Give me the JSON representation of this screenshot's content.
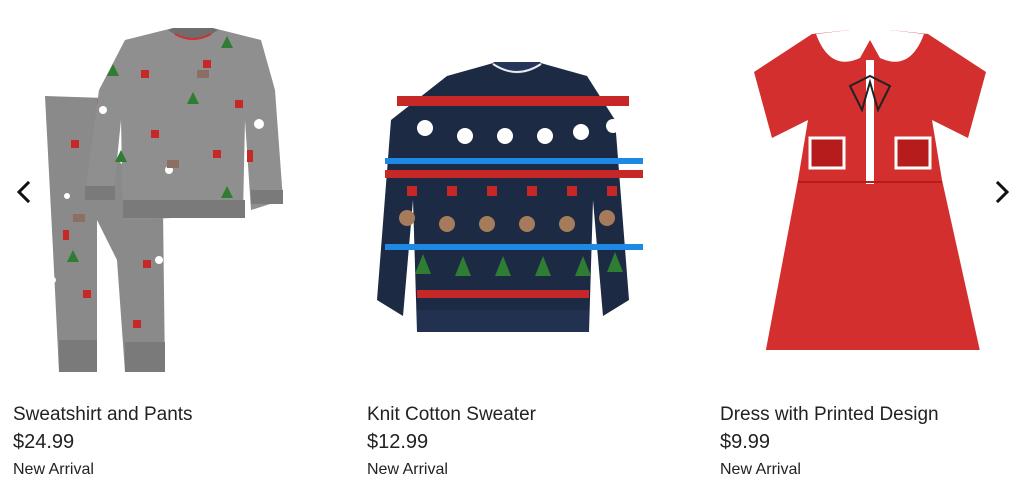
{
  "carousel": {
    "prev_icon": "chevron-left-icon",
    "next_icon": "chevron-right-icon",
    "products": [
      {
        "name": "Sweatshirt and Pants",
        "price": "$24.99",
        "badge": "New Arrival",
        "image": "gray-holiday-print-sweatshirt-and-pants"
      },
      {
        "name": "Knit Cotton Sweater",
        "price": "$12.99",
        "badge": "New Arrival",
        "image": "navy-fair-isle-holiday-sweater"
      },
      {
        "name": "Dress with Printed Design",
        "price": "$9.99",
        "badge": "New Arrival",
        "image": "red-dress-with-white-collar"
      }
    ]
  }
}
